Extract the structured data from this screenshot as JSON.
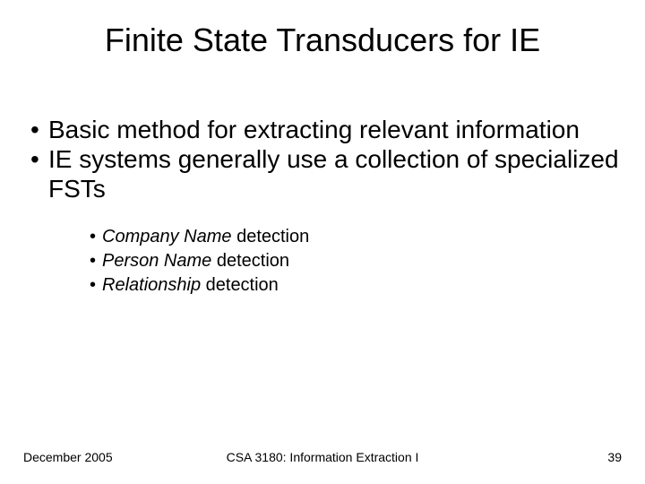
{
  "title": "Finite State Transducers for IE",
  "bullets": {
    "b1": "Basic method for extracting relevant information",
    "b2": "IE systems generally use a collection of specialized FSTs",
    "sub": {
      "s1_em": "Company Name",
      "s1_rest": " detection",
      "s2_em": "Person Name",
      "s2_rest": " detection",
      "s3_em": "Relationship",
      "s3_rest": " detection"
    }
  },
  "footer": {
    "date": "December 2005",
    "course": "CSA 3180: Information Extraction I",
    "page": "39"
  },
  "glyphs": {
    "dot": "•"
  }
}
